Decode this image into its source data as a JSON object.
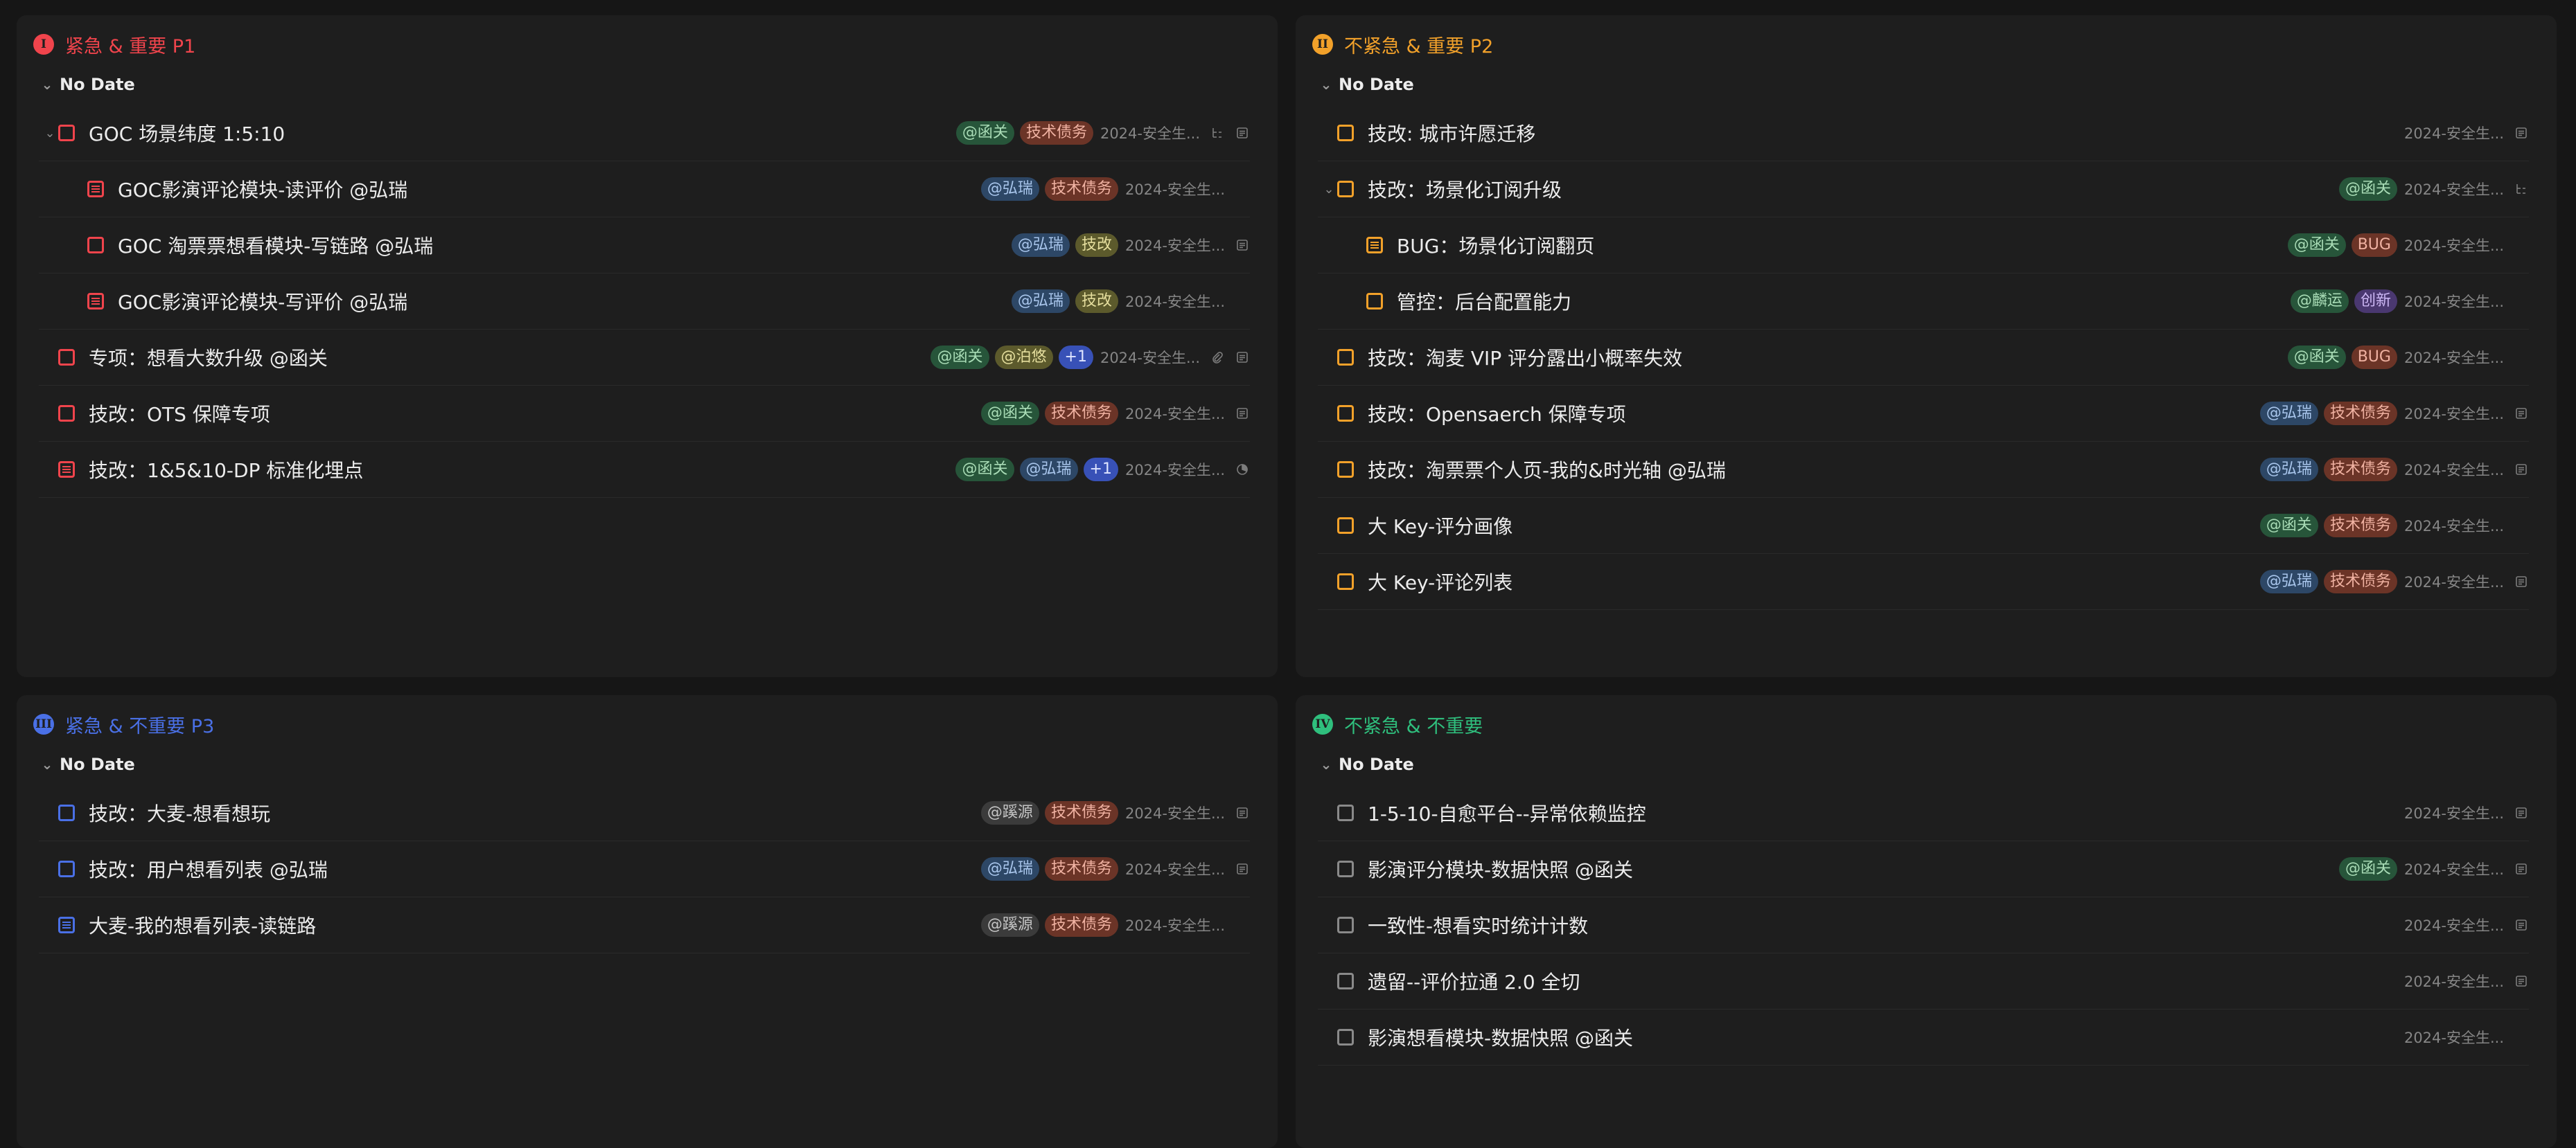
{
  "colors": {
    "p1": "#f0444c",
    "p2": "#f2a12a",
    "p3": "#4a70e6",
    "p4": "#2fbf7d",
    "p4_checkbox": "#8a8a8a"
  },
  "quadrants": [
    {
      "id": "p1",
      "badge": "I",
      "title": "紧急 & 重要 P1",
      "section": "No Date",
      "rows": [
        {
          "indent": 0,
          "expanded": true,
          "note": false,
          "title": "GOC 场景纬度 1:5:10",
          "tags": [
            {
              "t": "@函关",
              "c": "green"
            },
            {
              "t": "技术债务",
              "c": "red"
            }
          ],
          "date": "2024-安全生...",
          "icons": [
            "subtask-icon",
            "note-icon"
          ]
        },
        {
          "indent": 1,
          "expanded": false,
          "note": true,
          "title": "GOC影演评论模块-读评价 @弘瑞",
          "tags": [
            {
              "t": "@弘瑞",
              "c": "blue"
            },
            {
              "t": "技术债务",
              "c": "red"
            }
          ],
          "date": "2024-安全生...",
          "icons": []
        },
        {
          "indent": 1,
          "expanded": false,
          "note": false,
          "title": "GOC 淘票票想看模块-写链路 @弘瑞",
          "tags": [
            {
              "t": "@弘瑞",
              "c": "blue"
            },
            {
              "t": "技改",
              "c": "olive"
            }
          ],
          "date": "2024-安全生...",
          "icons": [
            "note-icon"
          ]
        },
        {
          "indent": 1,
          "expanded": false,
          "note": true,
          "title": "GOC影演评论模块-写评价 @弘瑞",
          "tags": [
            {
              "t": "@弘瑞",
              "c": "blue"
            },
            {
              "t": "技改",
              "c": "olive"
            }
          ],
          "date": "2024-安全生...",
          "icons": []
        },
        {
          "indent": 0,
          "expanded": false,
          "note": false,
          "title": "专项：想看大数升级 @函关",
          "tags": [
            {
              "t": "@函关",
              "c": "green"
            },
            {
              "t": "@泊悠",
              "c": "olive"
            },
            {
              "t": "+1",
              "c": "plus"
            }
          ],
          "date": "2024-安全生...",
          "icons": [
            "attachment-icon",
            "note-icon"
          ]
        },
        {
          "indent": 0,
          "expanded": false,
          "note": false,
          "title": "技改：OTS 保障专项",
          "tags": [
            {
              "t": "@函关",
              "c": "green"
            },
            {
              "t": "技术债务",
              "c": "red"
            }
          ],
          "date": "2024-安全生...",
          "icons": [
            "note-icon"
          ]
        },
        {
          "indent": 0,
          "expanded": false,
          "note": true,
          "title": "技改：1&5&10-DP 标准化埋点",
          "tags": [
            {
              "t": "@函关",
              "c": "green"
            },
            {
              "t": "@弘瑞",
              "c": "blue"
            },
            {
              "t": "+1",
              "c": "plus"
            }
          ],
          "date": "2024-安全生...",
          "icons": [
            "progress-icon"
          ]
        }
      ]
    },
    {
      "id": "p2",
      "badge": "II",
      "title": "不紧急 & 重要 P2",
      "section": "No Date",
      "rows": [
        {
          "indent": 0,
          "expanded": false,
          "note": false,
          "title": "技改: 城市许愿迁移",
          "tags": [],
          "date": "2024-安全生...",
          "icons": [
            "note-icon"
          ]
        },
        {
          "indent": 0,
          "expanded": true,
          "note": false,
          "title": "技改：场景化订阅升级",
          "tags": [
            {
              "t": "@函关",
              "c": "green"
            }
          ],
          "date": "2024-安全生...",
          "icons": [
            "subtask-icon"
          ]
        },
        {
          "indent": 1,
          "expanded": false,
          "note": true,
          "title": "BUG：场景化订阅翻页",
          "tags": [
            {
              "t": "@函关",
              "c": "green"
            },
            {
              "t": "BUG",
              "c": "red"
            }
          ],
          "date": "2024-安全生...",
          "icons": []
        },
        {
          "indent": 1,
          "expanded": false,
          "note": false,
          "title": "管控：后台配置能力",
          "tags": [
            {
              "t": "@麟运",
              "c": "green"
            },
            {
              "t": "创新",
              "c": "purple"
            }
          ],
          "date": "2024-安全生...",
          "icons": []
        },
        {
          "indent": 0,
          "expanded": false,
          "note": false,
          "title": "技改：淘麦 VIP 评分露出小概率失效",
          "tags": [
            {
              "t": "@函关",
              "c": "green"
            },
            {
              "t": "BUG",
              "c": "red"
            }
          ],
          "date": "2024-安全生...",
          "icons": []
        },
        {
          "indent": 0,
          "expanded": false,
          "note": false,
          "title": "技改：Opensaerch 保障专项",
          "tags": [
            {
              "t": "@弘瑞",
              "c": "blue"
            },
            {
              "t": "技术债务",
              "c": "red"
            }
          ],
          "date": "2024-安全生...",
          "icons": [
            "note-icon"
          ]
        },
        {
          "indent": 0,
          "expanded": false,
          "note": false,
          "title": "技改：淘票票个人页-我的&时光轴 @弘瑞",
          "tags": [
            {
              "t": "@弘瑞",
              "c": "blue"
            },
            {
              "t": "技术债务",
              "c": "red"
            }
          ],
          "date": "2024-安全生...",
          "icons": [
            "note-icon"
          ]
        },
        {
          "indent": 0,
          "expanded": false,
          "note": false,
          "title": "大 Key-评分画像",
          "tags": [
            {
              "t": "@函关",
              "c": "green"
            },
            {
              "t": "技术债务",
              "c": "red"
            }
          ],
          "date": "2024-安全生...",
          "icons": []
        },
        {
          "indent": 0,
          "expanded": false,
          "note": false,
          "title": "大 Key-评论列表",
          "tags": [
            {
              "t": "@弘瑞",
              "c": "blue"
            },
            {
              "t": "技术债务",
              "c": "red"
            }
          ],
          "date": "2024-安全生...",
          "icons": [
            "note-icon"
          ]
        }
      ]
    },
    {
      "id": "p3",
      "badge": "III",
      "title": "紧急 & 不重要 P3",
      "section": "No Date",
      "rows": [
        {
          "indent": 0,
          "expanded": false,
          "note": false,
          "title": "技改：大麦-想看想玩",
          "tags": [
            {
              "t": "@蹊源",
              "c": "grey"
            },
            {
              "t": "技术债务",
              "c": "red"
            }
          ],
          "date": "2024-安全生...",
          "icons": [
            "note-icon"
          ]
        },
        {
          "indent": 0,
          "expanded": false,
          "note": false,
          "title": "技改：用户想看列表 @弘瑞",
          "tags": [
            {
              "t": "@弘瑞",
              "c": "blue"
            },
            {
              "t": "技术债务",
              "c": "red"
            }
          ],
          "date": "2024-安全生...",
          "icons": [
            "note-icon"
          ]
        },
        {
          "indent": 0,
          "expanded": false,
          "note": true,
          "title": "大麦-我的想看列表-读链路",
          "tags": [
            {
              "t": "@蹊源",
              "c": "grey"
            },
            {
              "t": "技术债务",
              "c": "red"
            }
          ],
          "date": "2024-安全生...",
          "icons": []
        }
      ]
    },
    {
      "id": "p4",
      "badge": "IV",
      "title": "不紧急 & 不重要",
      "section": "No Date",
      "rows": [
        {
          "indent": 0,
          "expanded": false,
          "note": false,
          "title": "1-5-10-自愈平台--异常依赖监控",
          "tags": [],
          "date": "2024-安全生...",
          "icons": [
            "note-icon"
          ]
        },
        {
          "indent": 0,
          "expanded": false,
          "note": false,
          "title": "影演评分模块-数据快照 @函关",
          "tags": [
            {
              "t": "@函关",
              "c": "green"
            }
          ],
          "date": "2024-安全生...",
          "icons": [
            "note-icon"
          ]
        },
        {
          "indent": 0,
          "expanded": false,
          "note": false,
          "title": "一致性-想看实时统计计数",
          "tags": [],
          "date": "2024-安全生...",
          "icons": [
            "note-icon"
          ]
        },
        {
          "indent": 0,
          "expanded": false,
          "note": false,
          "title": "遗留--评价拉通 2.0 全切",
          "tags": [],
          "date": "2024-安全生...",
          "icons": [
            "note-icon"
          ]
        },
        {
          "indent": 0,
          "expanded": false,
          "note": false,
          "title": "影演想看模块-数据快照 @函关",
          "tags": [],
          "date": "2024-安全生...",
          "icons": []
        }
      ]
    }
  ]
}
